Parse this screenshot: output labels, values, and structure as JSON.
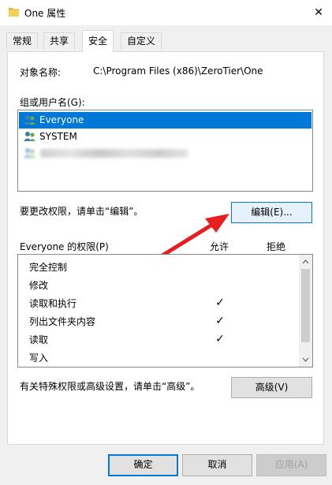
{
  "window": {
    "title": "One 属性",
    "close_glyph": "✕"
  },
  "tabs": [
    {
      "label": "常规"
    },
    {
      "label": "共享"
    },
    {
      "label": "安全"
    },
    {
      "label": "自定义"
    }
  ],
  "security": {
    "object_name_label": "对象名称:",
    "object_name_value": "C:\\Program Files (x86)\\ZeroTier\\One",
    "group_label": "组或用户名(G):",
    "users": [
      {
        "name": "Everyone"
      },
      {
        "name": "SYSTEM"
      },
      {
        "name": ""
      }
    ],
    "edit_hint": "要更改权限，请单击“编辑”。",
    "edit_button": "编辑(E)...",
    "perm_title": "Everyone 的权限(P)",
    "allow_header": "允许",
    "deny_header": "拒绝",
    "permissions": [
      {
        "name": "完全控制",
        "allow": ""
      },
      {
        "name": "修改",
        "allow": ""
      },
      {
        "name": "读取和执行",
        "allow": "✓"
      },
      {
        "name": "列出文件夹内容",
        "allow": "✓"
      },
      {
        "name": "读取",
        "allow": "✓"
      },
      {
        "name": "写入",
        "allow": ""
      }
    ],
    "advanced_hint": "有关特殊权限或高级设置，请单击“高级”。",
    "advanced_button": "高级(V)"
  },
  "footer": {
    "ok": "确定",
    "cancel": "取消",
    "apply": "应用(A)"
  },
  "colors": {
    "accent": "#0078d7",
    "annotation_arrow": "#e81e1e"
  },
  "icons": {
    "title": "folder-icon",
    "user": "users-group-icon",
    "annotation": "red-arrow-annotation"
  }
}
